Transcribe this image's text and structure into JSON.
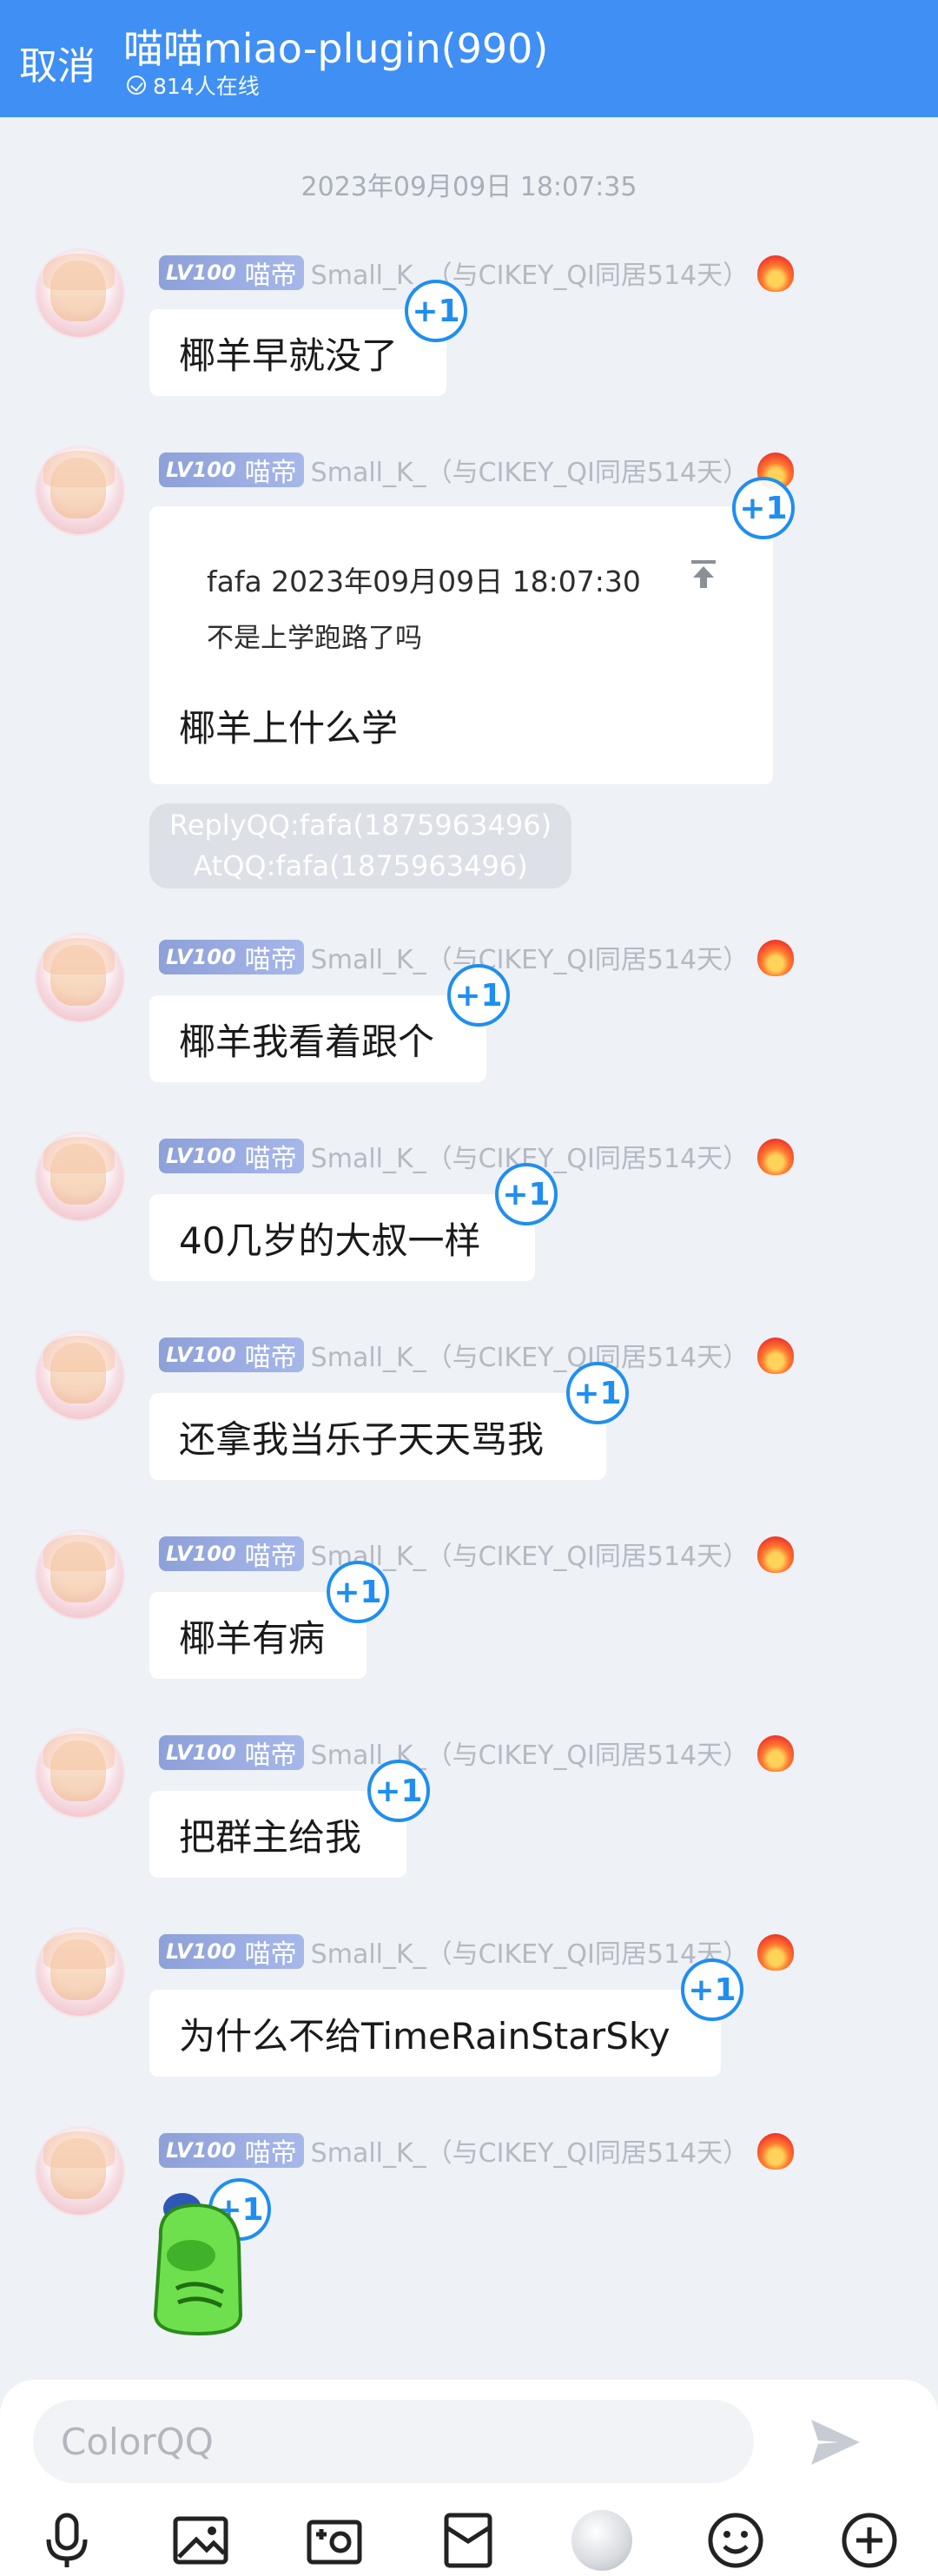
{
  "header": {
    "cancel": "取消",
    "title": "喵喵miao-plugin(990)",
    "online": "814人在线"
  },
  "timestamp": "2023年09月09日 18:07:35",
  "sender": {
    "level": "LV100",
    "rank": "喵帝",
    "name": "Small_K_（与CIKEY_QI同居514天）"
  },
  "plus_label": "+1",
  "messages": [
    {
      "text": "椰羊早就没了"
    },
    {
      "quote_head": "fafa 2023年09月09日 18:07:30",
      "quote_body": "不是上学跑路了吗",
      "text": "椰羊上什么学"
    },
    {
      "text": "椰羊我看着跟个"
    },
    {
      "text": "40几岁的大叔一样"
    },
    {
      "text": "还拿我当乐子天天骂我"
    },
    {
      "text": "椰羊有病"
    },
    {
      "text": "把群主给我"
    },
    {
      "text": "为什么不给TimeRainStarSky"
    }
  ],
  "system_msg": {
    "line1": "ReplyQQ:fafa(1875963496)",
    "line2": "AtQQ:fafa(1875963496)"
  },
  "composer": {
    "placeholder": "ColorQQ"
  },
  "colors": {
    "header": "#3f8ff5",
    "accent": "#1f8ef1",
    "background": "#eef1f6"
  },
  "icons": [
    "check-circle-icon",
    "pin-top-icon",
    "flame-icon",
    "send-icon",
    "mic-icon",
    "image-icon",
    "camera-icon",
    "red-packet-icon",
    "sticker-icon",
    "emoji-icon",
    "plus-icon"
  ]
}
